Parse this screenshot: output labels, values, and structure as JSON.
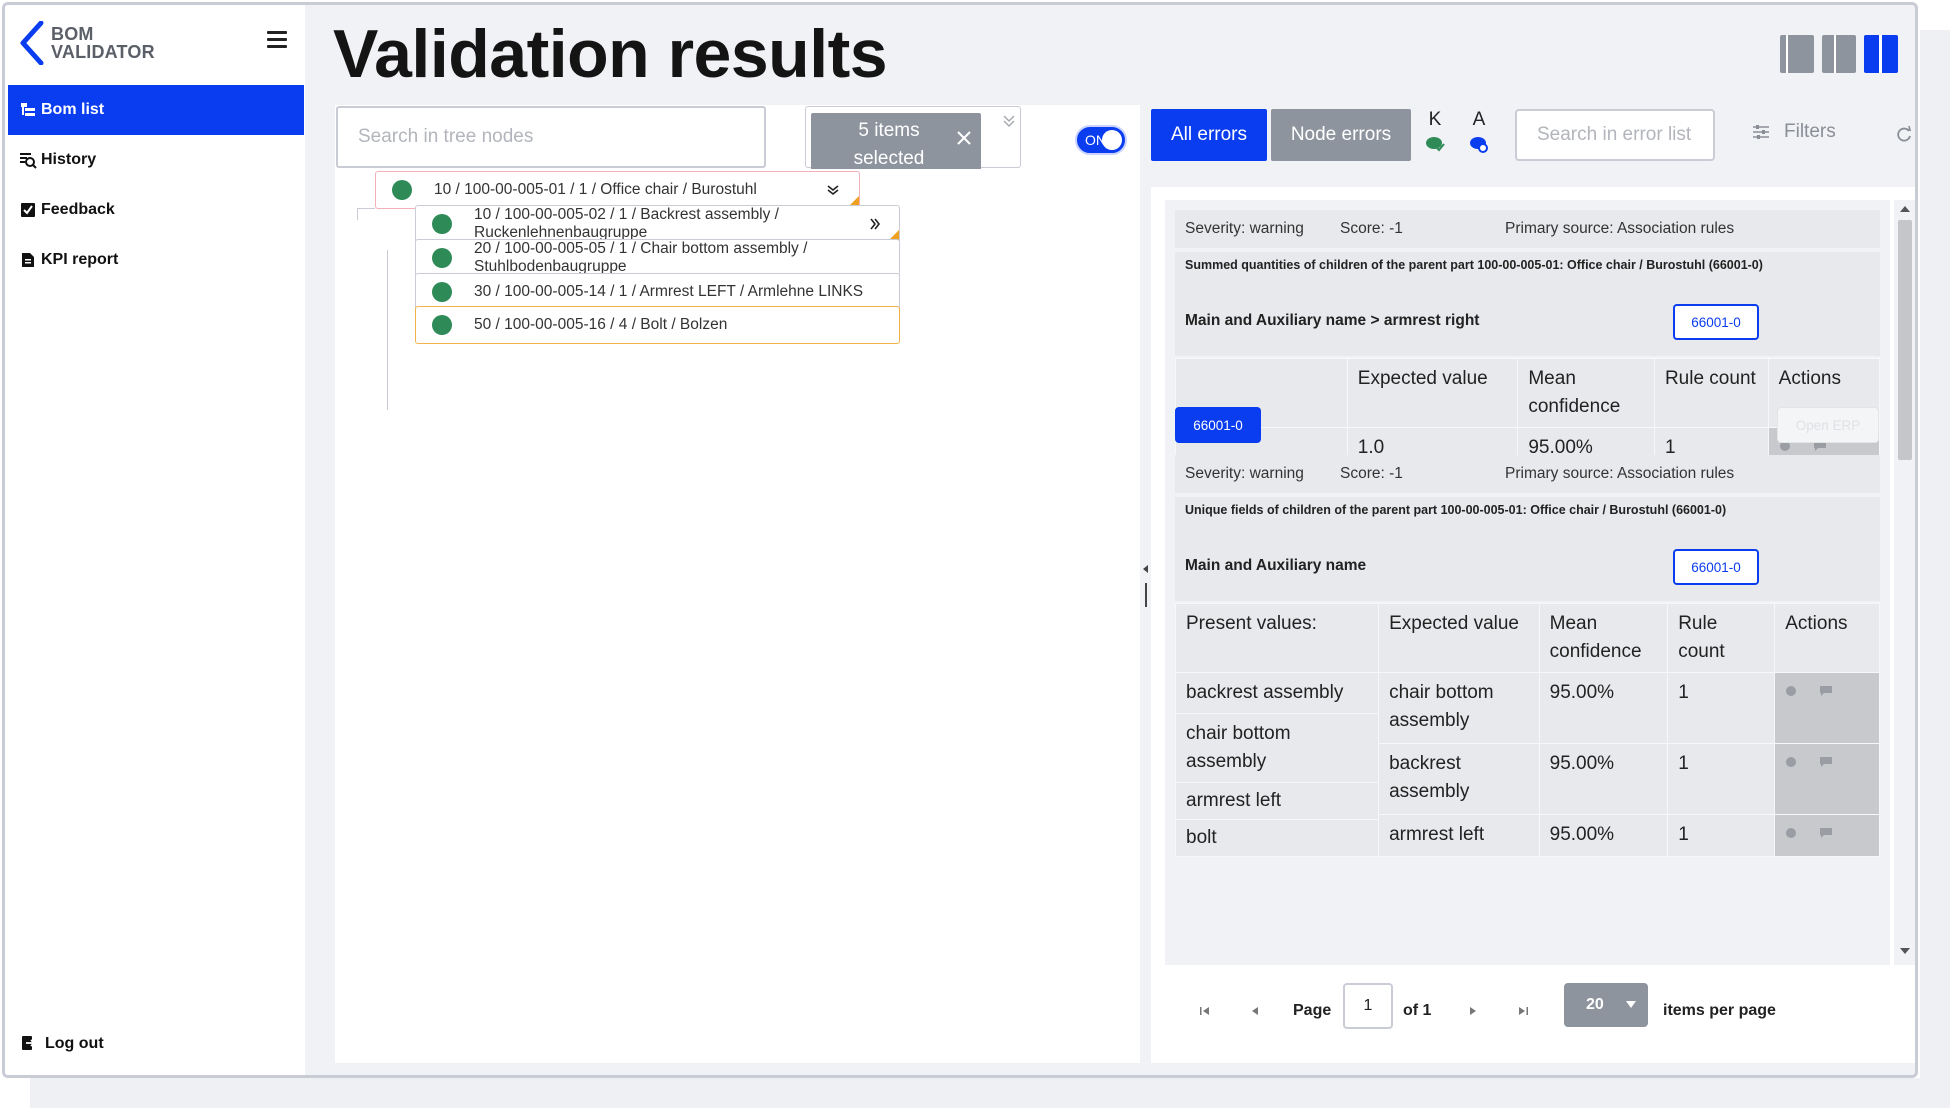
{
  "app": {
    "brand_line1": "BOM",
    "brand_line2": "VALIDATOR",
    "page_title": "Validation results"
  },
  "sidebar": {
    "items": [
      {
        "label": "Bom list",
        "icon": "tree-list-icon",
        "active": true
      },
      {
        "label": "History",
        "icon": "history-search-icon",
        "active": false
      },
      {
        "label": "Feedback",
        "icon": "checkbox-icon",
        "active": false
      },
      {
        "label": "KPI report",
        "icon": "document-icon",
        "active": false
      }
    ],
    "logout_label": "Log out"
  },
  "tree_panel": {
    "search_placeholder": "Search in tree nodes",
    "selection_chip": "5 items selected",
    "toggle_label": "ON",
    "nodes": [
      {
        "label": "10 / 100-00-005-01 / 1 / Office chair / Burostuhl"
      },
      {
        "label": "10 / 100-00-005-02 / 1 / Backrest assembly / Ruckenlehnenbaugruppe"
      },
      {
        "label": "20 / 100-00-005-05 / 1 / Chair bottom assembly / Stuhlbodenbaugruppe"
      },
      {
        "label": "30 / 100-00-005-14 / 1 / Armrest LEFT / Armlehne LINKS"
      },
      {
        "label": "50 / 100-00-005-16 / 4 / Bolt / Bolzen"
      }
    ]
  },
  "errors_panel": {
    "tab_all": "All errors",
    "tab_node": "Node errors",
    "k_label": "K",
    "a_label": "A",
    "search_placeholder": "Search in error list",
    "filters_label": "Filters",
    "colors": {
      "accent": "#0a3cf0",
      "inactive_tab": "#8e949e",
      "status_green": "#2e8b57"
    },
    "errors": [
      {
        "severity": "Severity: warning",
        "score": "Score: -1",
        "source": "Primary source: Association rules",
        "description": "Summed quantities of children of the parent part 100-00-005-01: Office chair / Burostuhl (66001-0)",
        "field": "Main and Auxiliary name > armrest right",
        "code": "66001-0",
        "headers": [
          "Expected value",
          "Mean confidence",
          "Rule count",
          "Actions"
        ],
        "row": [
          "1.0",
          "95.00%",
          "1"
        ],
        "badge": "66001-0",
        "open_erp": "Open ERP"
      },
      {
        "severity": "Severity: warning",
        "score": "Score: -1",
        "source": "Primary source: Association rules",
        "description": "Unique fields of children of the parent part 100-00-005-01: Office chair / Burostuhl (66001-0)",
        "field": "Main and Auxiliary name",
        "code": "66001-0",
        "present_header": "Present values:",
        "headers": [
          "Expected value",
          "Mean confidence",
          "Rule count",
          "Actions"
        ],
        "present_values": [
          "backrest assembly",
          "chair bottom assembly",
          "armrest left",
          "bolt"
        ],
        "rows": [
          [
            "chair bottom assembly",
            "95.00%",
            "1"
          ],
          [
            "backrest assembly",
            "95.00%",
            "1"
          ],
          [
            "armrest left",
            "95.00%",
            "1"
          ]
        ]
      }
    ]
  },
  "pagination": {
    "page_label": "Page",
    "page_value": "1",
    "of_label": "of 1",
    "per_page_value": "20",
    "per_page_label": "items per page"
  }
}
